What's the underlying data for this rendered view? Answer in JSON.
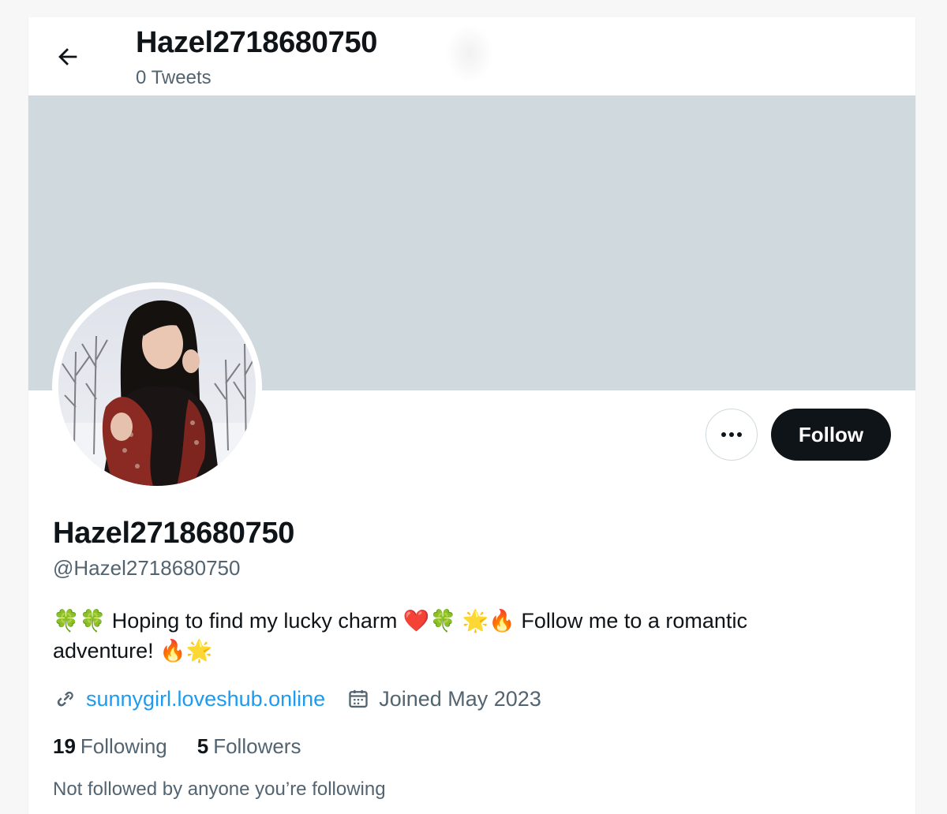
{
  "header": {
    "title": "Hazel2718680750",
    "subtitle": "0 Tweets",
    "back_icon": "arrow-left-icon"
  },
  "profile": {
    "display_name": "Hazel2718680750",
    "handle": "@Hazel2718680750",
    "bio_line1": "🍀🍀 Hoping to find my lucky charm ❤️🍀 🌟🔥 Follow me to a romantic",
    "bio_line2": "adventure! 🔥🌟",
    "website": "sunnygirl.loveshub.online",
    "joined": "Joined May 2023",
    "following_count": "19",
    "following_label": "Following",
    "followers_count": "5",
    "followers_label": "Followers",
    "mutuals_note": "Not followed by anyone you’re following"
  },
  "actions": {
    "more_icon": "more-horizontal-icon",
    "follow_label": "Follow"
  },
  "colors": {
    "banner": "#cfd9de",
    "text_primary": "#0f1419",
    "text_secondary": "#536471",
    "link": "#1d9bf0",
    "follow_bg": "#0f1419"
  }
}
